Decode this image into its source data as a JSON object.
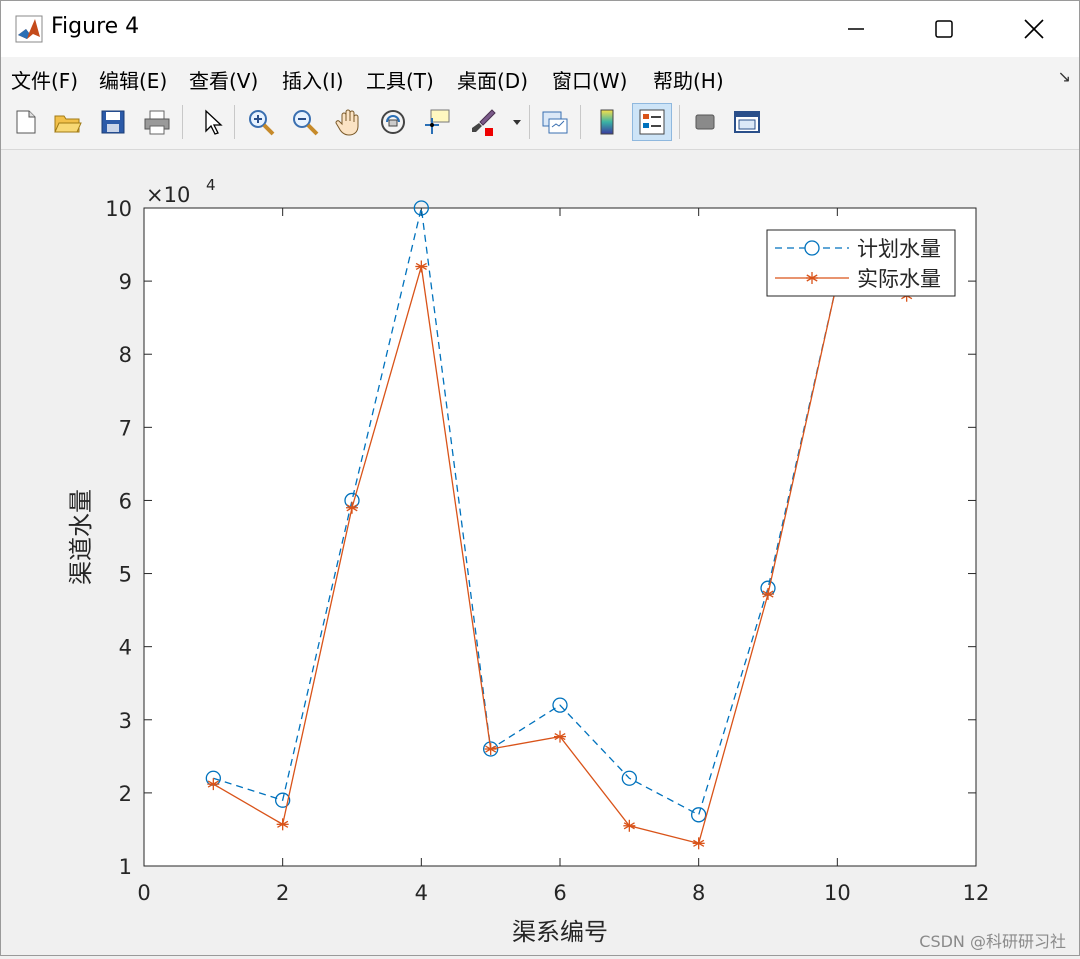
{
  "window": {
    "title": "Figure 4",
    "controls": {
      "minimize": "—",
      "maximize": "☐",
      "close": "✕"
    }
  },
  "menubar": {
    "items": [
      "文件(F)",
      "编辑(E)",
      "查看(V)",
      "插入(I)",
      "工具(T)",
      "桌面(D)",
      "窗口(W)",
      "帮助(H)"
    ],
    "overflow_arrow": "↘"
  },
  "toolbar": {
    "buttons": [
      {
        "name": "new-figure-icon"
      },
      {
        "name": "open-file-icon"
      },
      {
        "name": "save-icon"
      },
      {
        "name": "print-icon"
      },
      {
        "name": "select-pointer-icon"
      },
      {
        "name": "zoom-in-icon"
      },
      {
        "name": "zoom-out-icon"
      },
      {
        "name": "pan-hand-icon"
      },
      {
        "name": "rotate-3d-icon"
      },
      {
        "name": "data-cursor-icon"
      },
      {
        "name": "brush-icon"
      },
      {
        "name": "link-plot-icon"
      },
      {
        "name": "colorbar-icon"
      },
      {
        "name": "legend-icon"
      },
      {
        "name": "hide-tools-icon"
      },
      {
        "name": "dock-icon"
      }
    ]
  },
  "chart_data": {
    "type": "line",
    "xlabel": "渠系编号",
    "ylabel": "渠道水量",
    "exponent_label": "×10",
    "exponent_power": "4",
    "xlim": [
      0,
      12
    ],
    "ylim": [
      1,
      10
    ],
    "xticks": [
      0,
      2,
      4,
      6,
      8,
      10,
      12
    ],
    "yticks": [
      1,
      2,
      3,
      4,
      5,
      6,
      7,
      8,
      9,
      10
    ],
    "legend_position": "top-right",
    "series": [
      {
        "name": "计划水量",
        "color": "#0072BD",
        "line": "dashed",
        "marker": "circle",
        "x": [
          1,
          2,
          3,
          4,
          5,
          6,
          7,
          8,
          9,
          10,
          11
        ],
        "y": [
          2.2,
          1.9,
          6.0,
          10.0,
          2.6,
          3.2,
          2.2,
          1.7,
          4.8,
          9.0,
          9.0
        ]
      },
      {
        "name": "实际水量",
        "color": "#D95319",
        "line": "solid",
        "marker": "asterisk",
        "x": [
          1,
          2,
          3,
          4,
          5,
          6,
          7,
          8,
          9,
          10,
          11
        ],
        "y": [
          2.12,
          1.57,
          5.9,
          9.2,
          2.6,
          2.77,
          1.55,
          1.31,
          4.72,
          9.0,
          8.8
        ]
      }
    ]
  },
  "watermark": "CSDN @科研研习社"
}
